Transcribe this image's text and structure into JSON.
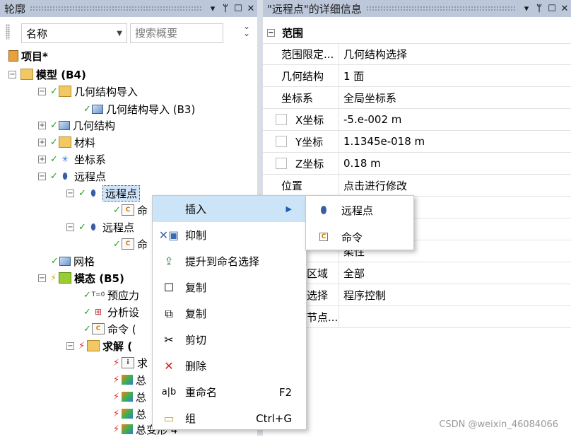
{
  "left_panel": {
    "title": "轮廓",
    "ctrl_pin": "▾",
    "ctrl_dock": "ᛘ",
    "ctrl_max": "☐",
    "ctrl_close": "✕",
    "name_select": "名称",
    "search_placeholder": "搜索概要",
    "tree": [
      {
        "label": "项目*",
        "icon": "book-icon"
      },
      {
        "label": "模型 (B4)",
        "icon": "model-folder-icon"
      },
      {
        "label": "几何结构导入",
        "icon": "folder-icon"
      },
      {
        "label": "几何结构导入 (B3)",
        "icon": "cube-icon"
      },
      {
        "label": "几何结构",
        "icon": "cube-icon"
      },
      {
        "label": "材料",
        "icon": "folder-icon"
      },
      {
        "label": "坐标系",
        "icon": "coordinate-icon"
      },
      {
        "label": "远程点",
        "icon": "remote-point-icon"
      },
      {
        "label": "远程点",
        "icon": "remote-point-icon"
      },
      {
        "label": "命",
        "icon": "command-icon"
      },
      {
        "label": "远程点",
        "icon": "remote-point-icon"
      },
      {
        "label": "命",
        "icon": "command-icon"
      },
      {
        "label": "网格",
        "icon": "mesh-icon"
      },
      {
        "label": "模态 (B5)",
        "icon": "modal-icon"
      },
      {
        "label": "预应力",
        "icon": "prestress-icon"
      },
      {
        "label": "分析设",
        "icon": "analysis-settings-icon"
      },
      {
        "label": "命令 (",
        "icon": "command-icon"
      },
      {
        "label": "求解 (",
        "icon": "solution-icon"
      },
      {
        "label": "求",
        "icon": "solution-info-icon"
      },
      {
        "label": "总",
        "icon": "result-icon"
      },
      {
        "label": "总",
        "icon": "result-icon"
      },
      {
        "label": "总",
        "icon": "result-icon"
      },
      {
        "label": "总变形 4",
        "icon": "result-icon"
      }
    ]
  },
  "right_panel": {
    "title": "\"远程点\"的详细信息",
    "section_scope": "范围",
    "rows": [
      {
        "key": "范围限定...",
        "value": "几何结构选择"
      },
      {
        "key": "几何结构",
        "value": "1 面"
      },
      {
        "key": "坐标系",
        "value": "全局坐标系"
      },
      {
        "key": "X坐标",
        "value": "-5.e-002 m"
      },
      {
        "key": "Y坐标",
        "value": "1.1345e-018 m"
      },
      {
        "key": "Z坐标",
        "value": "0.18 m"
      },
      {
        "key": "位置",
        "value": "点击进行修改"
      },
      {
        "key": "",
        "value": ""
      },
      {
        "key": "",
        "value": ""
      },
      {
        "key": "",
        "value": "柔性"
      },
      {
        "key": "区域",
        "value": "全部"
      },
      {
        "key": "选择",
        "value": "程序控制"
      },
      {
        "key": "节点...",
        "value": ""
      }
    ]
  },
  "context_menu": {
    "items": [
      {
        "label": "插入",
        "icon": "insert-icon",
        "shortcut": "▶"
      },
      {
        "label": "抑制",
        "icon": "suppress-icon",
        "shortcut": ""
      },
      {
        "label": "提升到命名选择",
        "icon": "promote-icon",
        "shortcut": ""
      },
      {
        "label": "复制",
        "icon": "duplicate-icon",
        "shortcut": ""
      },
      {
        "label": "复制",
        "icon": "copy-icon",
        "shortcut": ""
      },
      {
        "label": "剪切",
        "icon": "cut-icon",
        "shortcut": ""
      },
      {
        "label": "删除",
        "icon": "delete-icon",
        "shortcut": ""
      },
      {
        "label": "重命名",
        "icon": "rename-icon",
        "shortcut": "F2"
      },
      {
        "label": "组",
        "icon": "group-icon",
        "shortcut": "Ctrl+G"
      }
    ],
    "submenu": [
      {
        "label": "远程点",
        "icon": "remote-point-icon"
      },
      {
        "label": "命令",
        "icon": "command-icon"
      }
    ]
  },
  "watermark": "CSDN @weixin_46084066"
}
